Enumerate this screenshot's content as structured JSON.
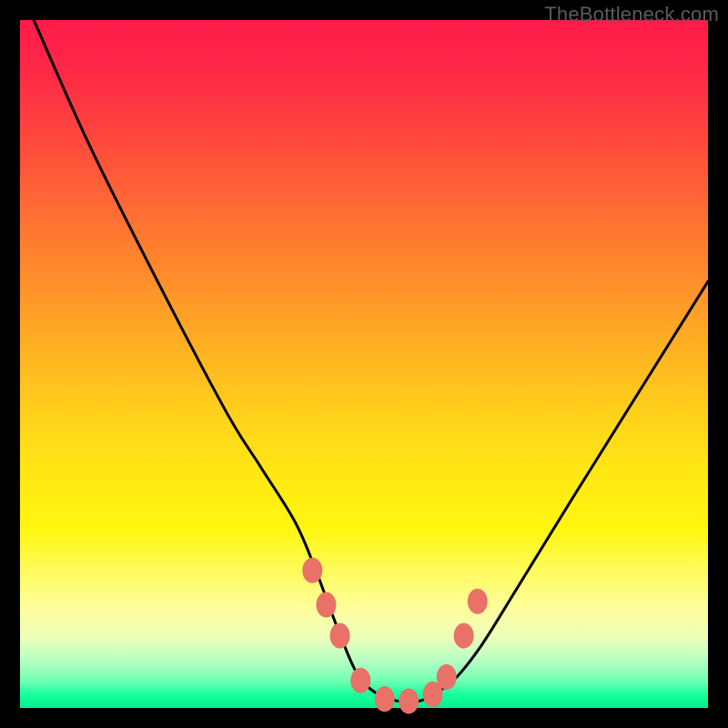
{
  "watermark": "TheBottleneck.com",
  "chart_data": {
    "type": "line",
    "title": "",
    "xlabel": "",
    "ylabel": "",
    "xlim": [
      0,
      100
    ],
    "ylim": [
      0,
      100
    ],
    "series": [
      {
        "name": "bottleneck-curve",
        "x": [
          2,
          10,
          20,
          30,
          35,
          40,
          43,
          46,
          49,
          52,
          55,
          58,
          60,
          63,
          67,
          72,
          80,
          90,
          100
        ],
        "values": [
          100,
          82,
          62,
          43,
          35,
          27,
          20,
          12,
          5,
          2,
          1,
          1,
          2,
          4,
          9,
          17,
          30,
          46,
          62
        ]
      }
    ],
    "markers": {
      "name": "highlight-dots",
      "x": [
        42.5,
        44.5,
        46.5,
        49.5,
        53.0,
        56.5,
        60.0,
        62.0,
        64.5,
        66.5
      ],
      "values": [
        20.0,
        15.0,
        10.5,
        4.0,
        1.3,
        1.0,
        2.0,
        4.5,
        10.5,
        15.5
      ]
    },
    "gradient_stops": [
      {
        "pos": 0,
        "color": "#ff1a4b"
      },
      {
        "pos": 50,
        "color": "#ffcc1e"
      },
      {
        "pos": 80,
        "color": "#fffb5c"
      },
      {
        "pos": 100,
        "color": "#00f08e"
      }
    ]
  }
}
